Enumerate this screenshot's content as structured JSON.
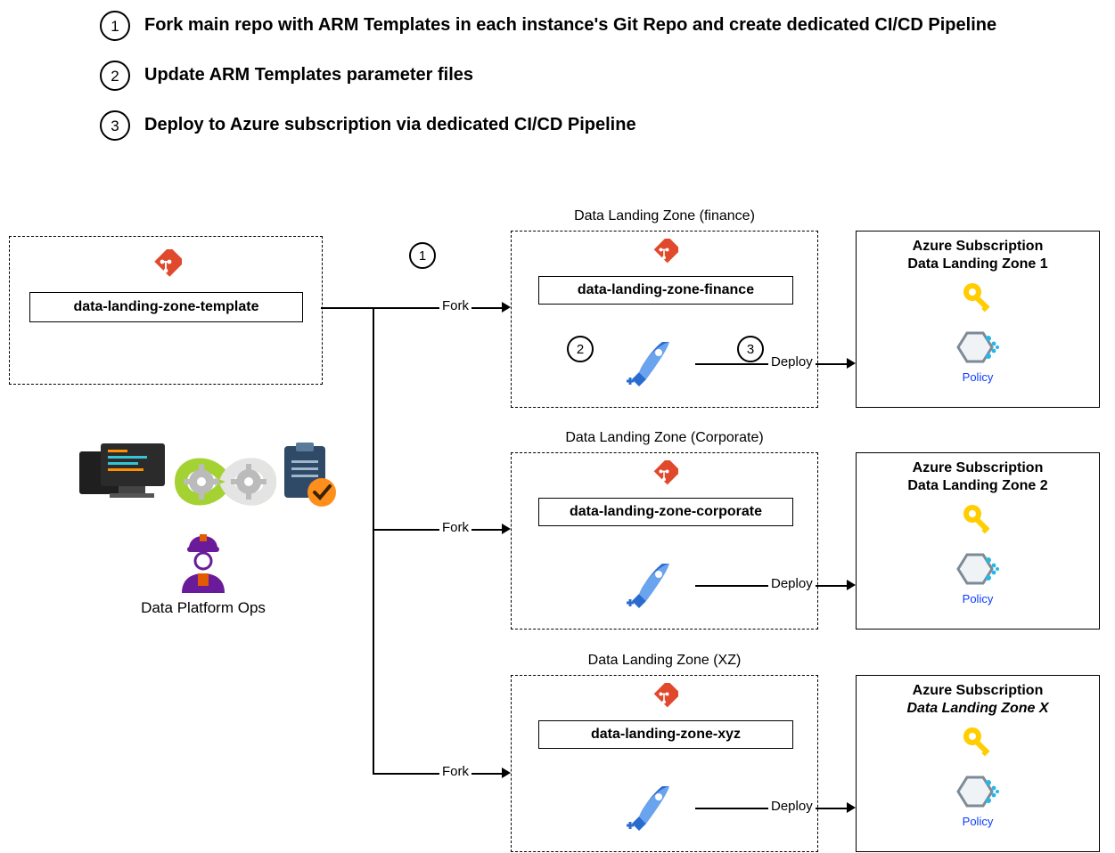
{
  "steps": [
    {
      "num": "1",
      "text": "Fork main repo with ARM Templates in each instance's Git Repo and create dedicated CI/CD Pipeline"
    },
    {
      "num": "2",
      "text": "Update ARM Templates parameter files"
    },
    {
      "num": "3",
      "text": "Deploy to Azure subscription via dedicated CI/CD Pipeline"
    }
  ],
  "source_repo": "data-landing-zone-template",
  "ops_label": "Data Platform Ops",
  "fork_label": "Fork",
  "deploy_label": "Deploy",
  "callouts": {
    "fork": "1",
    "update": "2",
    "deploy": "3"
  },
  "zones": [
    {
      "title": "Data Landing Zone (finance)",
      "repo": "data-landing-zone-finance",
      "sub_line1": "Azure Subscription",
      "sub_line2": "Data Landing Zone 1",
      "policy": "Policy"
    },
    {
      "title": "Data Landing Zone (Corporate)",
      "repo": "data-landing-zone-corporate",
      "sub_line1": "Azure Subscription",
      "sub_line2": "Data Landing Zone 2",
      "policy": "Policy"
    },
    {
      "title": "Data Landing Zone (XZ)",
      "repo": "data-landing-zone-xyz",
      "sub_line1": "Azure Subscription",
      "sub_line2": "Data Landing Zone X",
      "policy": "Policy"
    }
  ],
  "colors": {
    "git": "#e0492c",
    "rocket": "#2a6bd0",
    "rocket_light": "#6aa3ee",
    "key": "#ffcd00",
    "policy_hex": "#7d8a97",
    "policy_dot": "#28b6e6",
    "ops_primary": "#6a1b9a",
    "ops_accent": "#e25b00",
    "devops_blue": "#1976d2",
    "devops_green": "#a4d233",
    "devops_check": "#ff8f1c"
  }
}
